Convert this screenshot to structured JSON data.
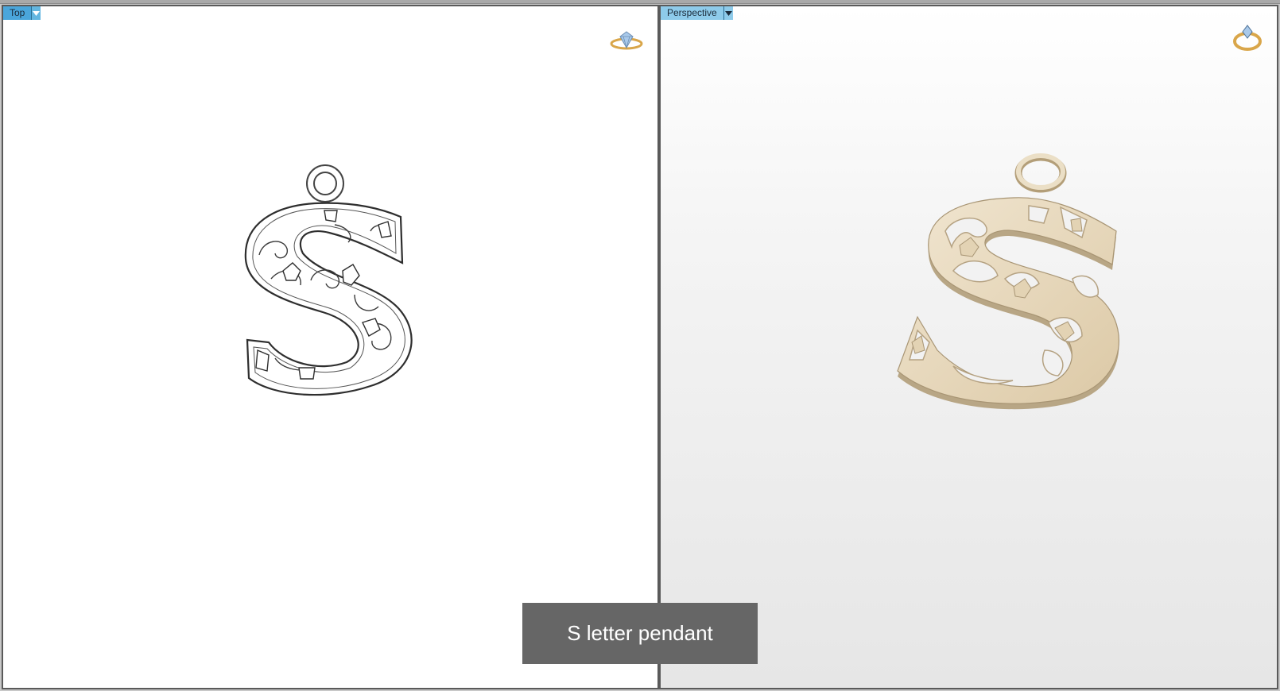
{
  "viewports": {
    "top": {
      "label": "Top"
    },
    "perspective": {
      "label": "Perspective"
    }
  },
  "icons": {
    "dropdown": "chevron-down-icon",
    "render_badge": "ring-icon"
  },
  "caption": "S letter pendant",
  "colors": {
    "label_bg": "#4aa6db",
    "gold": "#e9dcc3",
    "gold_edge": "#b8a685",
    "caption_bg": "#666666"
  }
}
